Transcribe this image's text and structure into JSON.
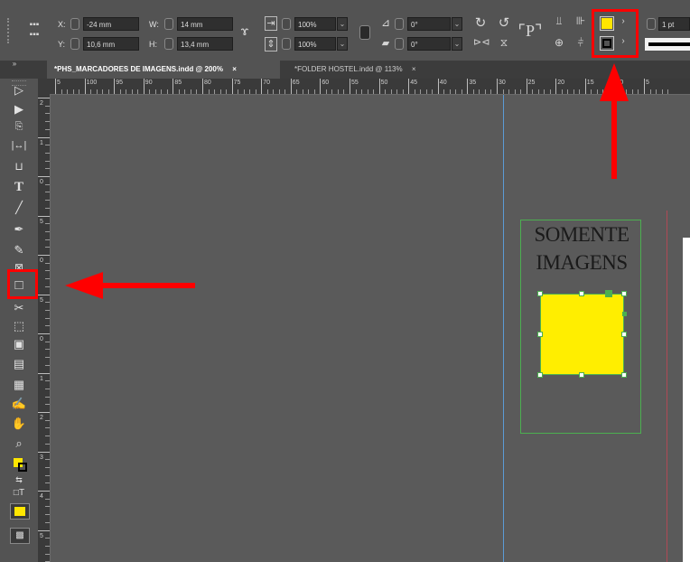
{
  "control_panel": {
    "x_label": "X:",
    "x_value": "-24 mm",
    "y_label": "Y:",
    "y_value": "10,6 mm",
    "w_label": "W:",
    "w_value": "14 mm",
    "h_label": "H:",
    "h_value": "13,4 mm",
    "scale_x": "100%",
    "scale_y": "100%",
    "rotate": "0°",
    "shear": "0°",
    "stroke_weight": "1 pt",
    "fill_color": "#ffe600",
    "stroke_color": "#000000"
  },
  "tabs": [
    {
      "label": "*PHS_MARCADORES DE IMAGENS.indd @ 200%",
      "close": "×"
    },
    {
      "label": "*FOLDER HOSTEL.indd @ 113%",
      "close": "×"
    }
  ],
  "ruler": {
    "h_labels": [
      "5",
      "100",
      "95",
      "90",
      "85",
      "80",
      "75",
      "70",
      "65",
      "60",
      "55",
      "50",
      "45",
      "40",
      "35",
      "30",
      "25",
      "20",
      "15",
      "10",
      "5"
    ],
    "v_labels": [
      "2",
      "1",
      "0",
      "5",
      "0",
      "5",
      "0",
      "1",
      "2",
      "3",
      "4",
      "5"
    ]
  },
  "canvas": {
    "frame_text_line1": "SOMENTE",
    "frame_text_line2": "IMAGENS",
    "rect_fill": "#ffee00",
    "guide_color": "#5b9bd5",
    "frame_color": "#4caf50"
  },
  "annotation_color": "#ff0000"
}
